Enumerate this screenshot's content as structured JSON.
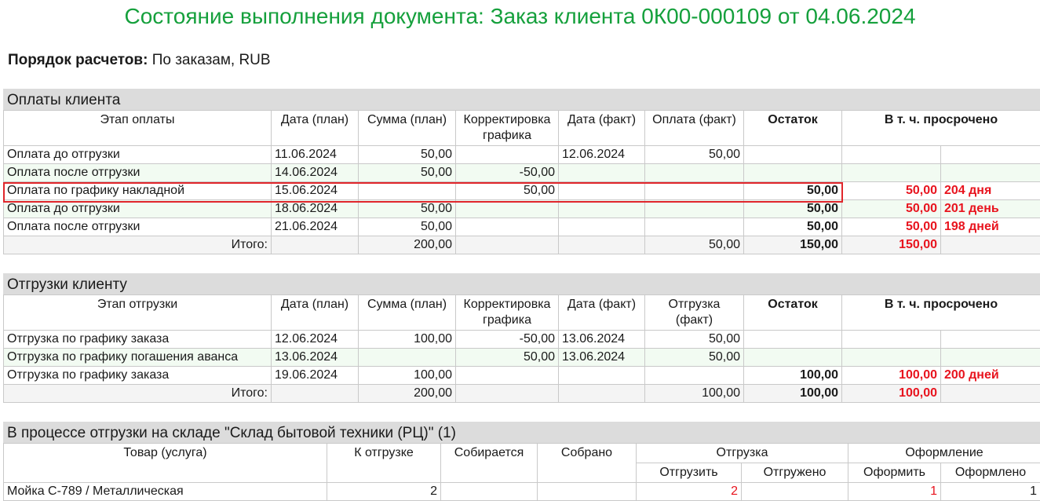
{
  "title": "Состояние выполнения документа: Заказ клиента 0К00-000109 от 04.06.2024",
  "settlement": {
    "label": "Порядок расчетов:",
    "value": "По заказам, RUB"
  },
  "payments": {
    "title": "Оплаты клиента",
    "headers": [
      "Этап оплаты",
      "Дата (план)",
      "Сумма (план)",
      "Корректировка графика",
      "Дата (факт)",
      "Оплата (факт)",
      "Остаток",
      "В т. ч. просрочено"
    ],
    "rows": [
      {
        "stage": "Оплата до отгрузки",
        "date_plan": "11.06.2024",
        "sum_plan": "50,00",
        "correction": "",
        "date_fact": "12.06.2024",
        "paid_fact": "50,00",
        "rest": "",
        "overdue": "",
        "overdue_days": ""
      },
      {
        "stage": "Оплата после отгрузки",
        "date_plan": "14.06.2024",
        "sum_plan": "50,00",
        "correction": "-50,00",
        "date_fact": "",
        "paid_fact": "",
        "rest": "",
        "overdue": "",
        "overdue_days": ""
      },
      {
        "stage": "Оплата по графику накладной",
        "date_plan": "15.06.2024",
        "sum_plan": "",
        "correction": "50,00",
        "date_fact": "",
        "paid_fact": "",
        "rest": "50,00",
        "overdue": "50,00",
        "overdue_days": "204 дня"
      },
      {
        "stage": "Оплата до отгрузки",
        "date_plan": "18.06.2024",
        "sum_plan": "50,00",
        "correction": "",
        "date_fact": "",
        "paid_fact": "",
        "rest": "50,00",
        "overdue": "50,00",
        "overdue_days": "201 день"
      },
      {
        "stage": "Оплата после отгрузки",
        "date_plan": "21.06.2024",
        "sum_plan": "50,00",
        "correction": "",
        "date_fact": "",
        "paid_fact": "",
        "rest": "50,00",
        "overdue": "50,00",
        "overdue_days": "198 дней"
      }
    ],
    "total": {
      "label": "Итого:",
      "sum_plan": "200,00",
      "paid_fact": "50,00",
      "rest": "150,00",
      "overdue": "150,00"
    }
  },
  "shipments": {
    "title": "Отгрузки клиенту",
    "headers": [
      "Этап отгрузки",
      "Дата (план)",
      "Сумма (план)",
      "Корректировка графика",
      "Дата (факт)",
      "Отгрузка (факт)",
      "Остаток",
      "В т. ч. просрочено"
    ],
    "rows": [
      {
        "stage": "Отгрузка по графику заказа",
        "date_plan": "12.06.2024",
        "sum_plan": "100,00",
        "correction": "-50,00",
        "date_fact": "13.06.2024",
        "shipped_fact": "50,00",
        "rest": "",
        "overdue": "",
        "overdue_days": ""
      },
      {
        "stage": "Отгрузка по графику погашения аванса",
        "date_plan": "13.06.2024",
        "sum_plan": "",
        "correction": "50,00",
        "date_fact": "13.06.2024",
        "shipped_fact": "50,00",
        "rest": "",
        "overdue": "",
        "overdue_days": ""
      },
      {
        "stage": "Отгрузка по графику заказа",
        "date_plan": "19.06.2024",
        "sum_plan": "100,00",
        "correction": "",
        "date_fact": "",
        "shipped_fact": "",
        "rest": "100,00",
        "overdue": "100,00",
        "overdue_days": "200 дней"
      }
    ],
    "total": {
      "label": "Итого:",
      "sum_plan": "200,00",
      "shipped_fact": "100,00",
      "rest": "100,00",
      "overdue": "100,00"
    }
  },
  "warehouse": {
    "title": "В процессе отгрузки на складе \"Склад бытовой техники (РЦ)\" (1)",
    "headers": {
      "product": "Товар (услуга)",
      "to_ship": "К отгрузке",
      "collecting": "Собирается",
      "collected": "Собрано",
      "shipment": "Отгрузка",
      "ship": "Отгрузить",
      "shipped": "Отгружено",
      "registration": "Оформление",
      "register": "Оформить",
      "registered": "Оформлено"
    },
    "rows": [
      {
        "product": "Мойка С-789 / Металлическая",
        "to_ship": "2",
        "collecting": "",
        "collected": "",
        "ship": "2",
        "shipped": "",
        "register": "1",
        "registered": "1"
      }
    ]
  },
  "colors": {
    "title_green": "#15a03c",
    "overdue_red": "#e8141e",
    "highlight_red": "#e0262b",
    "section_gray": "#dcdcdc"
  }
}
